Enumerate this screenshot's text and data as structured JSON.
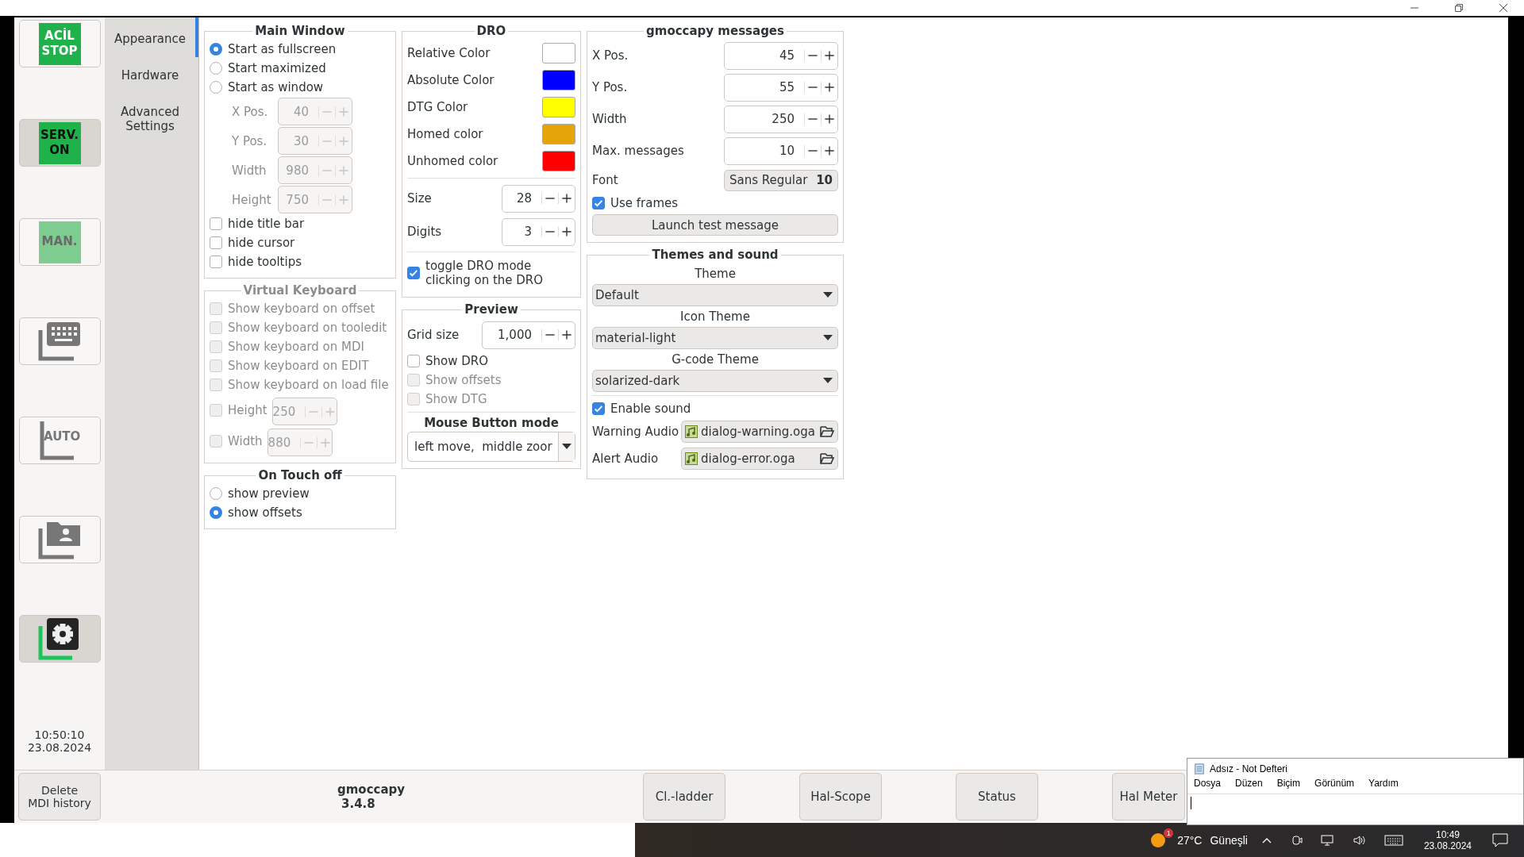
{
  "sidebar": {
    "buttons": [
      {
        "kind": "block",
        "lines": [
          "ACİL",
          "STOP"
        ],
        "color": "#1fb24a",
        "selected": false,
        "disabled": false
      },
      {
        "kind": "block",
        "lines": [
          "SERV.",
          "ON"
        ],
        "color": "#1fb24a",
        "selected": true,
        "disabled": false
      },
      {
        "kind": "block",
        "lines": [
          "MAN."
        ],
        "color": "#7fcc90",
        "selected": false,
        "disabled": true
      },
      {
        "kind": "keyboard",
        "selected": false
      },
      {
        "kind": "auto",
        "lines": [
          "AUTO"
        ],
        "selected": false
      },
      {
        "kind": "folder",
        "selected": false
      },
      {
        "kind": "settings",
        "selected": true
      }
    ],
    "clock": {
      "time": "10:50:10",
      "date": "23.08.2024"
    }
  },
  "tabs": [
    {
      "label": "Appearance",
      "selected": true
    },
    {
      "label": "Hardware",
      "selected": false
    },
    {
      "label": "Advanced Settings",
      "selected": false
    }
  ],
  "main_window": {
    "title": "Main Window",
    "options": [
      {
        "label": "Start as fullscreen",
        "selected": true
      },
      {
        "label": "Start maximized",
        "selected": false
      },
      {
        "label": "Start as window",
        "selected": false
      }
    ],
    "fields": [
      {
        "label": "X Pos.",
        "value": "40",
        "disabled": true
      },
      {
        "label": "Y Pos.",
        "value": "30",
        "disabled": true
      },
      {
        "label": "Width",
        "value": "980",
        "disabled": true
      },
      {
        "label": "Height",
        "value": "750",
        "disabled": true
      }
    ],
    "checkboxes": [
      {
        "label": "hide title bar",
        "checked": false
      },
      {
        "label": "hide cursor",
        "checked": false
      },
      {
        "label": "hide tooltips",
        "checked": false
      }
    ]
  },
  "virtual_keyboard": {
    "title": "Virtual Keyboard",
    "disabled": true,
    "checkboxes": [
      {
        "label": "Show keyboard on offset",
        "checked": false
      },
      {
        "label": "Show keyboard on tooledit",
        "checked": false
      },
      {
        "label": "Show keyboard on MDI",
        "checked": false
      },
      {
        "label": "Show keyboard on EDIT",
        "checked": false
      },
      {
        "label": "Show keyboard on load file",
        "checked": false
      }
    ],
    "sizes": [
      {
        "label": "Height",
        "value": "250",
        "checked": false
      },
      {
        "label": "Width",
        "value": "880",
        "checked": false
      }
    ]
  },
  "on_touch_off": {
    "title": "On Touch off",
    "options": [
      {
        "label": "show preview",
        "selected": false
      },
      {
        "label": "show offsets",
        "selected": true
      }
    ]
  },
  "dro": {
    "title": "DRO",
    "colors": [
      {
        "label": "Relative Color",
        "color": "#ffffff"
      },
      {
        "label": "Absolute Color",
        "color": "#0000ff"
      },
      {
        "label": "DTG Color",
        "color": "#ffff00"
      },
      {
        "label": "Homed color",
        "color": "#e5a50a"
      },
      {
        "label": "Unhomed color",
        "color": "#ff0000"
      }
    ],
    "spins": [
      {
        "label": "Size",
        "value": "28"
      },
      {
        "label": "Digits",
        "value": "3"
      }
    ],
    "toggle": {
      "label": "toggle DRO mode clicking on the DRO",
      "checked": true
    }
  },
  "preview": {
    "title": "Preview",
    "grid": {
      "label": "Grid size",
      "value": "1,000"
    },
    "checkboxes": [
      {
        "label": "Show DRO",
        "checked": false,
        "disabled": false
      },
      {
        "label": "Show offsets",
        "checked": false,
        "disabled": true
      },
      {
        "label": "Show DTG",
        "checked": false,
        "disabled": true
      }
    ],
    "mouse_mode": {
      "title": "Mouse Button mode",
      "value": "left move,  middle zoor"
    }
  },
  "messages": {
    "title": "gmoccapy messages",
    "spins": [
      {
        "label": "X Pos.",
        "value": "45"
      },
      {
        "label": "Y Pos.",
        "value": "55"
      },
      {
        "label": "Width",
        "value": "250"
      },
      {
        "label": "Max. messages",
        "value": "10"
      }
    ],
    "font": {
      "label": "Font",
      "name": "Sans Regular",
      "size": "10"
    },
    "use_frames": {
      "label": "Use frames",
      "checked": true
    },
    "button": "Launch test message"
  },
  "themes": {
    "title": "Themes and sound",
    "selects": [
      {
        "label": "Theme",
        "value": "Default"
      },
      {
        "label": "Icon Theme",
        "value": "material-light"
      },
      {
        "label": "G-code Theme",
        "value": "solarized-dark"
      }
    ],
    "sound": {
      "label": "Enable sound",
      "checked": true
    },
    "audio": [
      {
        "label": "Warning Audio",
        "file": "dialog-warning.oga"
      },
      {
        "label": "Alert Audio",
        "file": "dialog-error.oga"
      }
    ]
  },
  "bottom_bar": {
    "delete_button": [
      "Delete",
      "MDI history"
    ],
    "app_name": "gmoccapy",
    "version": "3.4.8",
    "buttons": [
      "Cl.-ladder",
      "Hal-Scope",
      "Status",
      "Hal Meter"
    ]
  },
  "notepad": {
    "title": "Adsız - Not Defteri",
    "menu": [
      "Dosya",
      "Düzen",
      "Biçim",
      "Görünüm",
      "Yardım"
    ]
  },
  "taskbar": {
    "weather": {
      "badge": "1",
      "temperature": "27°C",
      "condition": "Güneşli"
    },
    "time": "10:49",
    "date": "23.08.2024"
  }
}
